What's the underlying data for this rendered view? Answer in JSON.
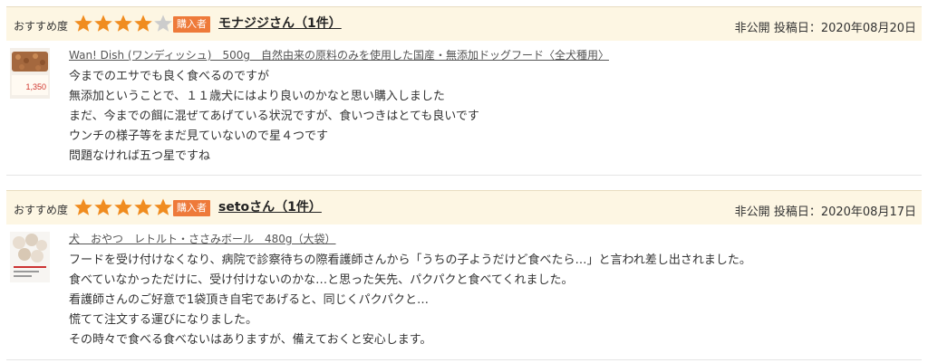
{
  "reviews": [
    {
      "rec_label": "おすすめ度",
      "rating": 4,
      "max_rating": 5,
      "badge": "購入者",
      "reviewer": "モナジジさん（1件）",
      "visibility": "非公開",
      "post_date_label": "投稿日：2020年08月20日",
      "product": "Wan! Dish (ワンディッシュ)　500g　自然由来の原料のみを使用した国産・無添加ドッグフード〈全犬種用〉",
      "thumb_text": "1,350",
      "lines": [
        "今までのエサでも良く食べるのですが",
        "無添加ということで、１１歳犬にはより良いのかなと思い購入しました",
        "まだ、今までの餌に混ぜてあげている状況ですが、食いつきはとても良いです",
        "ウンチの様子等をまだ見ていないので星４つです",
        "問題なければ五つ星ですね"
      ]
    },
    {
      "rec_label": "おすすめ度",
      "rating": 5,
      "max_rating": 5,
      "badge": "購入者",
      "reviewer": "setoさん（1件）",
      "visibility": "非公開",
      "post_date_label": "投稿日：2020年08月17日",
      "product": "犬　おやつ　レトルト・ささみボール　480g（大袋）",
      "thumb_text": "",
      "lines": [
        "フードを受け付けなくなり、病院で診察待ちの際看護師さんから「うちの子ようだけど食べたら…」と言われ差し出されました。",
        "食べていなかっただけに、受け付けないのかな…と思った矢先、パクパクと食べてくれました。",
        "看護師さんのご好意で1袋頂き自宅であげると、同じくパクパクと…",
        "慌てて注文する運びになりました。",
        "その時々で食べる食べないはありますが、備えておくと安心します。"
      ]
    }
  ],
  "colors": {
    "star_filled": "#f08c1f",
    "star_empty": "#cccccc",
    "badge": "#ee7a3a",
    "header_bg": "#fdf6e3"
  }
}
